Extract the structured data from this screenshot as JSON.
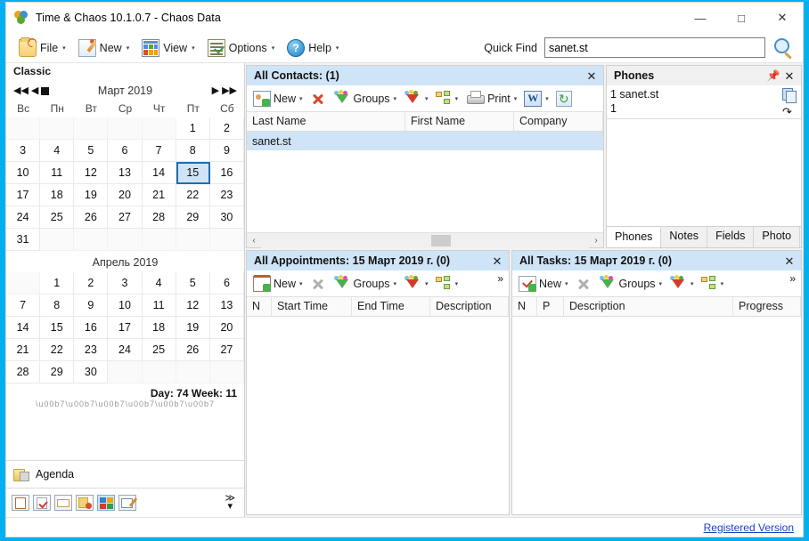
{
  "window": {
    "title": "Time & Chaos 10.1.0.7 - Chaos Data",
    "app_icon": "chaos-balloons-icon",
    "minimize": "—",
    "maximize": "□",
    "close": "✕",
    "border_color": "#00b0f0"
  },
  "toolbar": {
    "items": [
      {
        "label": "File",
        "icon": "open-folder-icon",
        "caret": "▾"
      },
      {
        "label": "New",
        "icon": "pencil-note-icon",
        "caret": "▾"
      },
      {
        "label": "View",
        "icon": "view-grid-icon",
        "caret": "▾"
      },
      {
        "label": "Options",
        "icon": "options-list-icon",
        "caret": "▾"
      },
      {
        "label": "Help",
        "icon": "help-question-icon",
        "caret": "▾"
      }
    ],
    "quick_find_label": "Quick Find",
    "quick_find_value": "sanet.st",
    "quick_find_placeholder": "",
    "search_icon": "magnifier-icon"
  },
  "sidebar": {
    "header": "Classic",
    "nav": {
      "prev_year": "◀◀",
      "prev_month": "◀",
      "today": "stop-square-icon",
      "next_month": "▶",
      "next_year": "▶▶"
    },
    "month1": {
      "title": "Март 2019",
      "dow": [
        "Вс",
        "Пн",
        "Вт",
        "Ср",
        "Чт",
        "Пт",
        "Сб"
      ],
      "lead_blanks": 5,
      "days": 31,
      "selected": 15
    },
    "month2": {
      "title": "Апрель 2019",
      "lead_blanks": 1,
      "days": 30,
      "selected": 0
    },
    "day_week": "Day: 74 Week: 11",
    "agenda_label": "Agenda",
    "agenda_icon": "agenda-folder-icon",
    "modules": [
      {
        "name": "module-contacts",
        "icon": "contacts-card-icon",
        "selected": false
      },
      {
        "name": "module-tasks",
        "icon": "task-check-icon",
        "selected": false
      },
      {
        "name": "module-phonebook",
        "icon": "phone-book-icon",
        "selected": false
      },
      {
        "name": "module-appointments",
        "icon": "appointment-clock-icon",
        "selected": false
      },
      {
        "name": "module-classic",
        "icon": "four-color-grid-icon",
        "selected": true
      },
      {
        "name": "module-notes",
        "icon": "notepad-pencil-icon",
        "selected": false
      }
    ],
    "more_icon": "≫",
    "more_caret": "▾"
  },
  "contacts_panel": {
    "title": "All Contacts:  (1)",
    "close": "✕",
    "toolbar": [
      {
        "label": "New",
        "icon": "new-contact-icon",
        "caret": "▾"
      },
      {
        "label": "",
        "icon": "delete-x-icon",
        "caret": ""
      },
      {
        "label": "Groups",
        "icon": "green-funnel-icon",
        "caret": "▾"
      },
      {
        "label": "",
        "icon": "red-funnel-icon",
        "caret": "▾"
      },
      {
        "label": "",
        "icon": "tree-hierarchy-icon",
        "caret": "▾"
      },
      {
        "label": "Print",
        "icon": "printer-icon",
        "caret": "▾"
      },
      {
        "label": "",
        "icon": "word-export-icon",
        "caret": "▾"
      },
      {
        "label": "",
        "icon": "refresh-icon",
        "caret": ""
      }
    ],
    "columns": [
      "Last Name",
      "First Name",
      "Company"
    ],
    "rows": [
      {
        "last_name": "sanet.st",
        "first_name": "",
        "company": "",
        "selected": true
      }
    ],
    "scroll_left": "‹",
    "scroll_right": "›"
  },
  "phones_panel": {
    "title": "Phones",
    "pin": "📌",
    "close": "✕",
    "lines": [
      "1  sanet.st",
      "1"
    ],
    "copy_icon": "copy-icon",
    "dial_icon": "dial-arrow-icon",
    "tabs": [
      {
        "label": "Phones",
        "active": true
      },
      {
        "label": "Notes",
        "active": false
      },
      {
        "label": "Fields",
        "active": false
      },
      {
        "label": "Photo",
        "active": false
      }
    ]
  },
  "appointments_panel": {
    "title": "All Appointments: 15 Март 2019 г.  (0)",
    "close": "✕",
    "toolbar": [
      {
        "label": "New",
        "icon": "new-appointment-icon",
        "caret": "▾"
      },
      {
        "label": "",
        "icon": "delete-x-icon",
        "caret": ""
      },
      {
        "label": "Groups",
        "icon": "green-funnel-icon",
        "caret": "▾"
      },
      {
        "label": "",
        "icon": "red-funnel-icon",
        "caret": "▾"
      },
      {
        "label": "",
        "icon": "tree-hierarchy-icon",
        "caret": "▾"
      }
    ],
    "more": "»",
    "columns": [
      "N",
      "Start Time",
      "End Time",
      "Description"
    ],
    "rows": []
  },
  "tasks_panel": {
    "title": "All Tasks: 15 Март 2019 г.  (0)",
    "close": "✕",
    "toolbar": [
      {
        "label": "New",
        "icon": "new-task-icon",
        "caret": "▾"
      },
      {
        "label": "",
        "icon": "delete-x-icon",
        "caret": ""
      },
      {
        "label": "Groups",
        "icon": "green-funnel-icon",
        "caret": "▾"
      },
      {
        "label": "",
        "icon": "red-funnel-icon",
        "caret": "▾"
      },
      {
        "label": "",
        "icon": "tree-hierarchy-icon",
        "caret": "▾"
      }
    ],
    "more": "»",
    "columns": [
      "N",
      "P",
      "Description",
      "Progress"
    ],
    "rows": []
  },
  "statusbar": {
    "registered": "Registered Version"
  }
}
